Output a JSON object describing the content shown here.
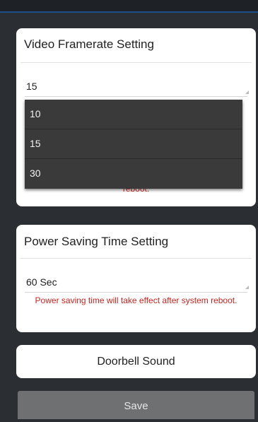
{
  "framerate": {
    "title": "Video Framerate Setting",
    "selected_value": "15",
    "options": [
      "10",
      "15",
      "30"
    ],
    "note": "reboot."
  },
  "power_saving": {
    "title": "Power Saving Time Setting",
    "selected_value": "60 Sec",
    "note": "Power saving time will take effect after system reboot."
  },
  "doorbell": {
    "label": "Doorbell Sound"
  },
  "save": {
    "label": "Save"
  }
}
